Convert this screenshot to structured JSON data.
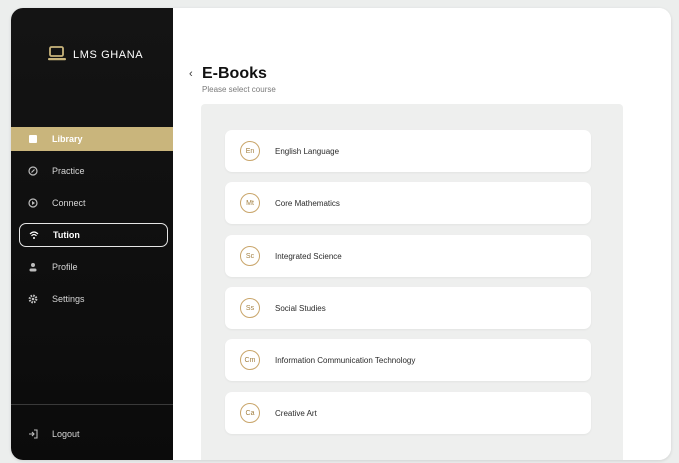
{
  "brand": {
    "name": "LMS GHANA",
    "accent": "#c9b57c"
  },
  "sidebar": {
    "items": [
      {
        "label": "Library",
        "icon": "book-icon",
        "state": "active"
      },
      {
        "label": "Practice",
        "icon": "edit-icon",
        "state": "normal"
      },
      {
        "label": "Connect",
        "icon": "play-icon",
        "state": "normal"
      },
      {
        "label": "Tution",
        "icon": "wifi-icon",
        "state": "outlined"
      },
      {
        "label": "Profile",
        "icon": "user-icon",
        "state": "normal"
      },
      {
        "label": "Settings",
        "icon": "gear-icon",
        "state": "normal"
      }
    ],
    "logout_label": "Logout"
  },
  "main": {
    "title": "E-Books",
    "subtitle": "Please select course",
    "courses": [
      {
        "abbr": "En",
        "name": "English Language"
      },
      {
        "abbr": "Mt",
        "name": "Core Mathematics"
      },
      {
        "abbr": "Sc",
        "name": "Integrated Science"
      },
      {
        "abbr": "Ss",
        "name": "Social Studies"
      },
      {
        "abbr": "Cm",
        "name": "Information Communication Technology"
      },
      {
        "abbr": "Ca",
        "name": "Creative Art"
      }
    ]
  }
}
